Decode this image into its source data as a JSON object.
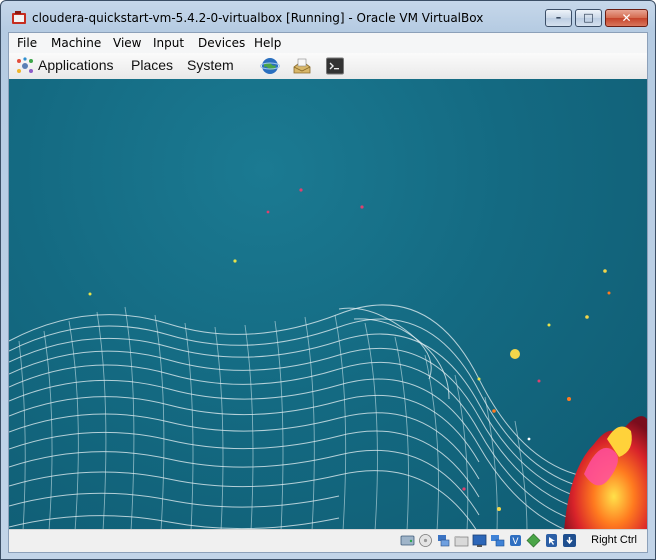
{
  "window": {
    "title": "cloudera-quickstart-vm-5.4.2-0-virtualbox [Running] - Oracle VM VirtualBox",
    "minimize_label": "–",
    "maximize_label": "□",
    "close_label": "✕"
  },
  "menubar": {
    "items": [
      "File",
      "Machine",
      "View",
      "Input",
      "Devices",
      "Help"
    ]
  },
  "gnome_panel": {
    "menus": [
      "Applications",
      "Places",
      "System"
    ],
    "launchers": [
      "web-browser-icon",
      "mail-client-icon",
      "terminal-icon"
    ]
  },
  "statusbar": {
    "icons": [
      "hard-disk-icon",
      "optical-drive-icon",
      "usb-icon",
      "shared-folders-icon",
      "display-icon",
      "network-icon",
      "video-capture-icon",
      "cpu-virtualization-icon",
      "mouse-integration-icon",
      "keyboard-capture-icon"
    ],
    "host_key": "Right Ctrl"
  },
  "colors": {
    "desktop_bg": "#146a82",
    "title_gradient": "#c6d7ea",
    "close_button": "#c5432a"
  }
}
